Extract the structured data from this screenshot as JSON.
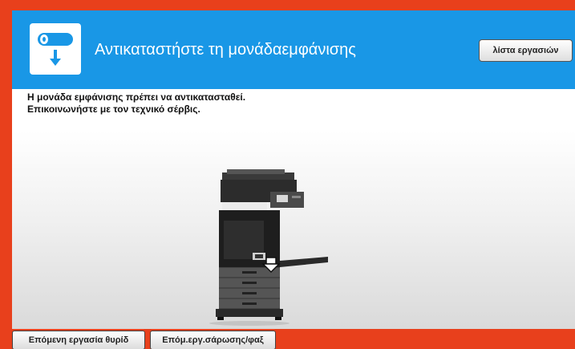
{
  "header": {
    "title": "Αντικαταστήστε τη μονάδαεμφάνισης",
    "icon": "developing-unit-replace-icon",
    "job_list_label": "λίστα εργασιών"
  },
  "message": {
    "line1": "Η μονάδα εμφάνισης πρέπει να αντικατασταθεί.",
    "line2": "Επικοινωνήστε με τον τεχνικό σέρβις."
  },
  "illustration": {
    "subject": "printer-icon",
    "indicator": "arrow-down-icon"
  },
  "footer": {
    "next_job_label": "Επόμενη εργασία θυρίδ",
    "next_scan_fax_label": "Επόμ.εργ.σάρωσης/φαξ"
  },
  "colors": {
    "frame": "#e8401c",
    "header": "#1997e6",
    "panel": "#ffffff"
  }
}
